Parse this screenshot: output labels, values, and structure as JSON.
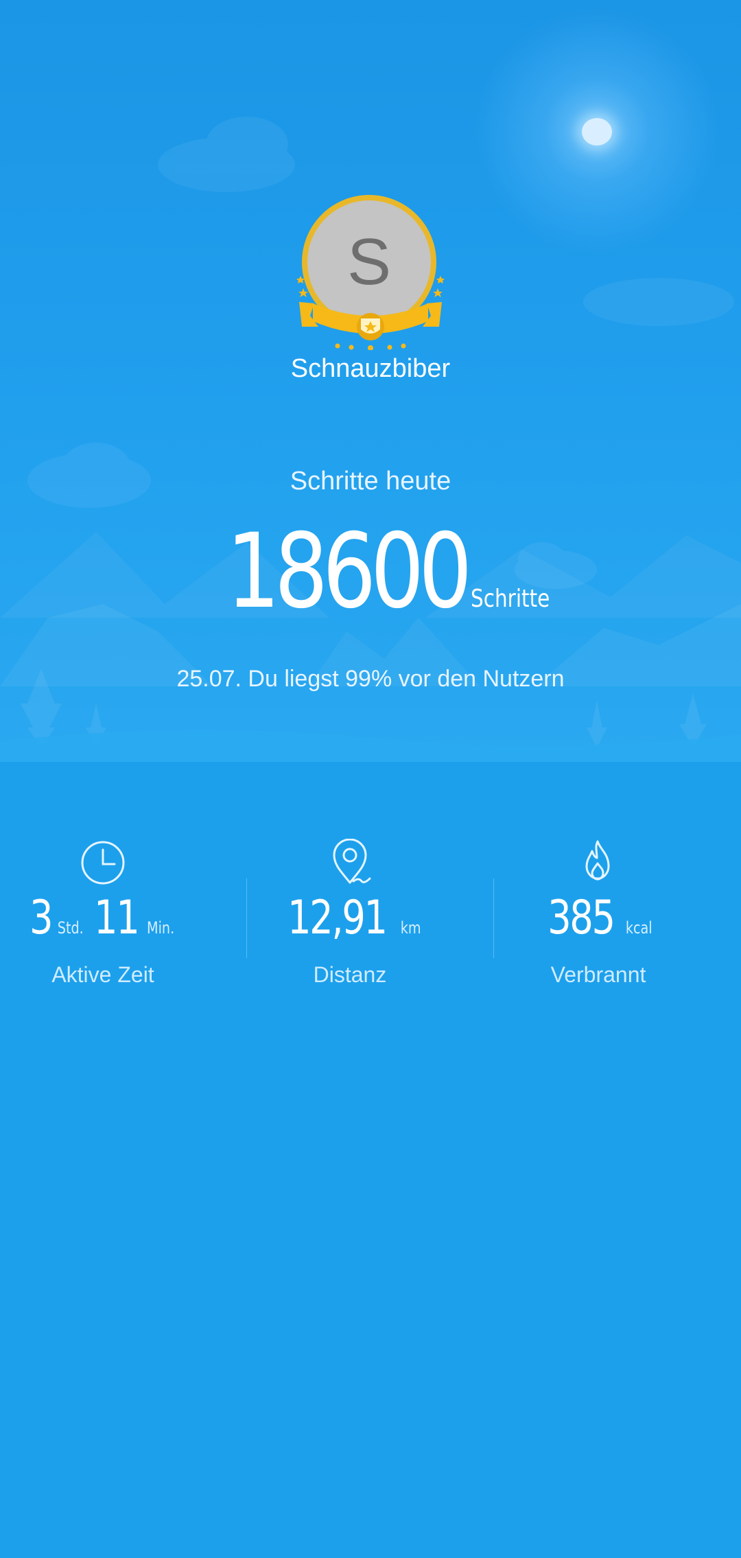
{
  "profile": {
    "avatar_initial": "S",
    "name": "Schnauzbiber"
  },
  "steps": {
    "title": "Schritte heute",
    "value": "18600",
    "unit": "Schritte",
    "ranking": "25.07. Du liegst 99% vor den Nutzern"
  },
  "stats": {
    "active_time": {
      "hours": "3",
      "hours_unit": "Std.",
      "minutes": "11",
      "minutes_unit": "Min.",
      "label": "Aktive Zeit",
      "icon": "clock-icon"
    },
    "distance": {
      "value": "12,91",
      "unit": "km",
      "label": "Distanz",
      "icon": "location-pin-icon"
    },
    "burned": {
      "value": "385",
      "unit": "kcal",
      "label": "Verbrannt",
      "icon": "flame-icon"
    }
  },
  "colors": {
    "background": "#1ca0ec",
    "badge_gold": "#f6b917",
    "text": "#ffffff"
  }
}
